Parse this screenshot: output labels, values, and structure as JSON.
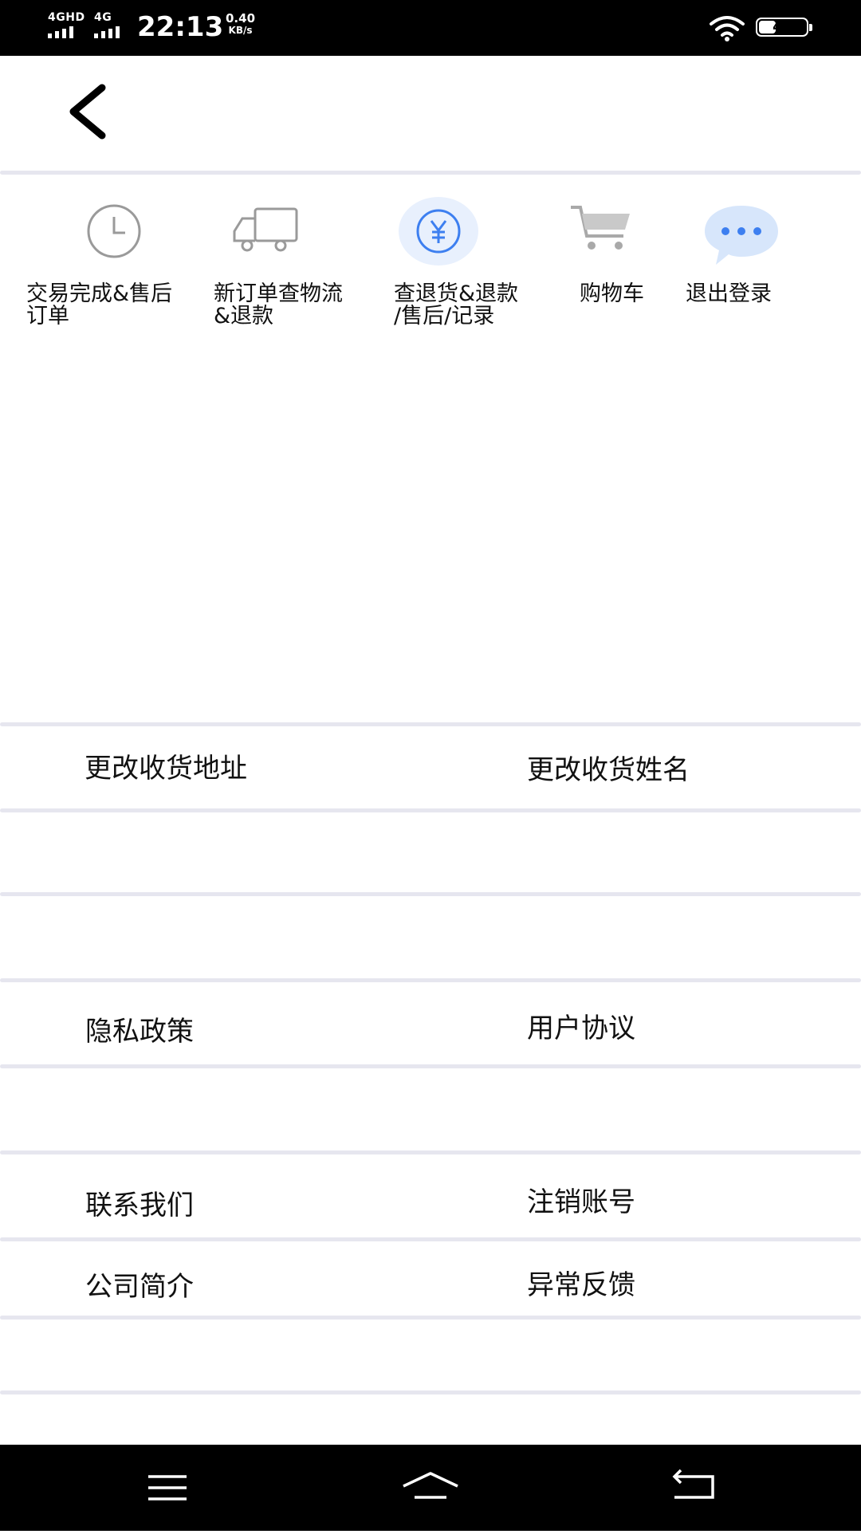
{
  "status_bar": {
    "network_1": "4GHD",
    "network_2": "4G",
    "time": "22:13",
    "speed_value": "0.40",
    "speed_unit": "KB/s",
    "battery": "41",
    "battery_level": 0.41
  },
  "header": {
    "back_icon": "chevron-left-icon"
  },
  "quick_actions": [
    {
      "label": "交易完成&售后\n订单",
      "icon": "clock-icon"
    },
    {
      "label": "新订单查物流\n&退款",
      "icon": "truck-icon"
    },
    {
      "label": "查退货&退款\n/售后/记录",
      "icon": "yuan-icon"
    },
    {
      "label": "购物车",
      "icon": "cart-icon"
    },
    {
      "label": "退出登录",
      "icon": "chat-bubble-icon"
    }
  ],
  "settings": {
    "change_address": "更改收货地址",
    "change_name": "更改收货姓名",
    "privacy_policy": "隐私政策",
    "user_agreement": "用户协议",
    "contact_us": "联系我们",
    "delete_account": "注销账号",
    "company_intro": "公司简介",
    "feedback": "异常反馈"
  },
  "nav_bar": {
    "menu_icon": "menu-icon",
    "home_icon": "home-icon",
    "back_icon": "back-arrow-icon"
  },
  "colors": {
    "divider": "#e6e6ef",
    "accent_blue": "#3d7ff0",
    "icon_gray": "#9a9a9a"
  }
}
